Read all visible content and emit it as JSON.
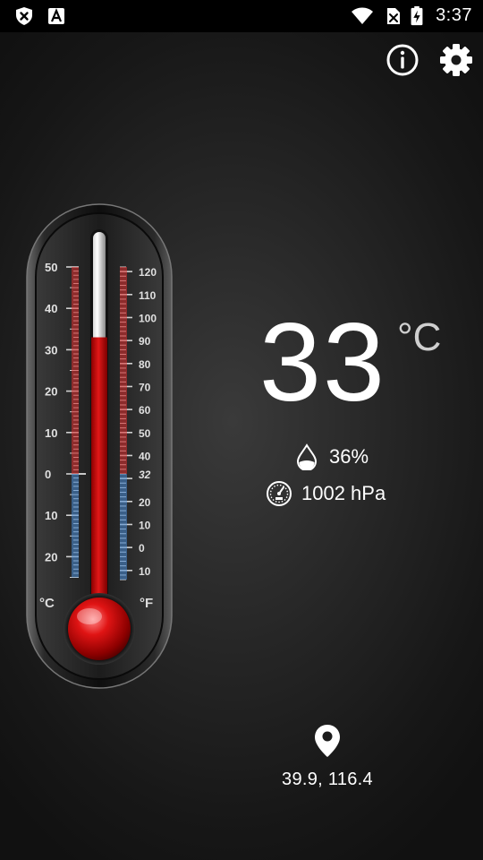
{
  "status_bar": {
    "time": "3:37",
    "icons": [
      "shield-x-icon",
      "text-a-icon",
      "wifi-icon",
      "no-sim-icon",
      "battery-charging-icon"
    ]
  },
  "toolbar": {
    "info_icon": "info-icon",
    "settings_icon": "gear-icon"
  },
  "thermometer": {
    "celsius_label": "°C",
    "fahrenheit_label": "°F",
    "celsius_ticks": [
      "50",
      "40",
      "30",
      "20",
      "10",
      "0",
      "10",
      "20"
    ],
    "fahrenheit_ticks": [
      "120",
      "110",
      "100",
      "90",
      "80",
      "70",
      "60",
      "50",
      "40",
      "32",
      "20",
      "10",
      "0",
      "10"
    ],
    "mercury_celsius": 33,
    "scale_min_celsius": -25,
    "scale_max_celsius": 50
  },
  "reading": {
    "temperature": "33",
    "unit": "°C"
  },
  "humidity": {
    "value": "36%",
    "icon": "droplet-icon"
  },
  "pressure": {
    "value": "1002 hPa",
    "icon": "gauge-icon"
  },
  "location": {
    "coordinates": "39.9, 116.4",
    "icon": "map-pin-icon"
  },
  "colors": {
    "mercury": "#c81010",
    "celsius_scale": "#e03030",
    "fahrenheit_scale": "#e03030",
    "cold_scale": "#4a8ed8"
  }
}
